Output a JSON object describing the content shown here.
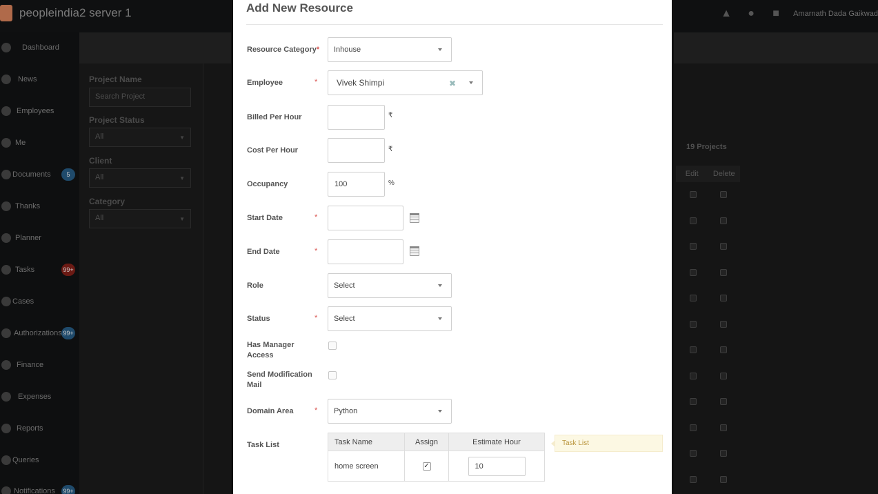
{
  "app": {
    "title": "peopleindia2 server 1",
    "user_name": "Amarnath Dada Gaikwad"
  },
  "sidebar": {
    "items": [
      {
        "label": "Dashboard"
      },
      {
        "label": "News"
      },
      {
        "label": "Employees"
      },
      {
        "label": "Me"
      },
      {
        "label": "Documents",
        "badge": "5"
      },
      {
        "label": "Thanks"
      },
      {
        "label": "Planner"
      },
      {
        "label": "Tasks",
        "badge": "99+"
      },
      {
        "label": "Cases"
      },
      {
        "label": "Authorizations",
        "badge": "99+"
      },
      {
        "label": "Finance"
      },
      {
        "label": "Expenses"
      },
      {
        "label": "Reports"
      },
      {
        "label": "Queries"
      },
      {
        "label": "Notifications",
        "badge": "99+"
      }
    ]
  },
  "filters": {
    "project_name_label": "Project Name",
    "project_name_placeholder": "Search Project",
    "project_status_label": "Project Status",
    "project_status_value": "All",
    "client_label": "Client",
    "client_value": "All",
    "category_label": "Category",
    "category_value": "All"
  },
  "projects": {
    "count": "19 Projects",
    "col_edit": "Edit",
    "col_delete": "Delete"
  },
  "modal": {
    "title": "Add New Resource",
    "resource_category": {
      "label": "Resource Category",
      "value": "Inhouse"
    },
    "employee": {
      "label": "Employee",
      "value": "Vivek Shimpi"
    },
    "billed_per_hour": {
      "label": "Billed Per Hour",
      "value": "",
      "unit": "₹"
    },
    "cost_per_hour": {
      "label": "Cost Per Hour",
      "value": "",
      "unit": "₹"
    },
    "occupancy": {
      "label": "Occupancy",
      "value": "100",
      "unit": "%"
    },
    "start_date": {
      "label": "Start Date",
      "value": ""
    },
    "end_date": {
      "label": "End Date",
      "value": ""
    },
    "role": {
      "label": "Role",
      "value": "Select"
    },
    "status": {
      "label": "Status",
      "value": "Select"
    },
    "has_manager_access": {
      "label_line1": "Has Manager",
      "label_line2": "Access",
      "checked": false
    },
    "send_modification_mail": {
      "label_line1": "Send Modification",
      "label_line2": "Mail",
      "checked": false
    },
    "domain_area": {
      "label": "Domain Area",
      "value": "Python"
    },
    "task_list": {
      "label": "Task List",
      "columns": [
        "Task Name",
        "Assign",
        "Estimate Hour"
      ],
      "rows": [
        {
          "task_name": "home screen",
          "assigned": true,
          "estimate": "10"
        }
      ],
      "tooltip": "Task List"
    },
    "required_mark": "*"
  }
}
